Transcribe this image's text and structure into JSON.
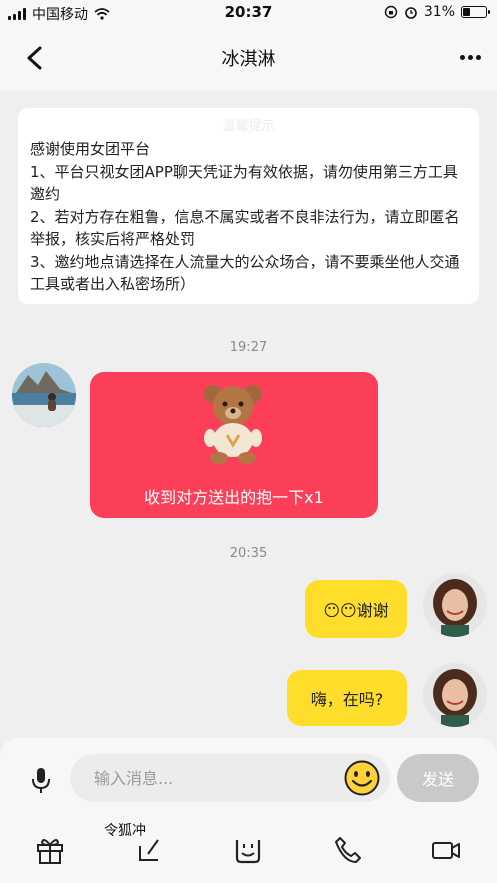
{
  "status_bar": {
    "carrier": "中国移动",
    "time": "20:37",
    "battery": "31%",
    "battery_level": 0.31
  },
  "header": {
    "title": "冰淇淋"
  },
  "notice": {
    "faint_title": "温馨提示",
    "lines": [
      "感谢使用女团平台",
      "1、平台只视女团APP聊天凭证为有效依据，请勿使用第三方工具邀约",
      "2、若对方存在粗鲁，信息不属实或者不良非法行为，请立即匿名举报，核实后将严格处罚",
      "3、邀约地点请选择在人流量大的公众场合，请不要乘坐他人交通工具或者出入私密场所）"
    ]
  },
  "messages": {
    "time_1": "19:27",
    "gift_text": "收到对方送出的抱一下x1",
    "time_2": "20:35",
    "msg_1": "😶😶谢谢",
    "msg_2": "嗨，在吗?"
  },
  "input": {
    "placeholder": "输入消息...",
    "send_label": "发送",
    "overlay_text": "令狐冲"
  },
  "icons": {
    "back": "chevron-left-icon",
    "more": "more-dots-icon",
    "mic": "microphone-icon",
    "emoji": "smiley-emoji-icon",
    "toolbar": [
      "gift-icon",
      "edit-icon",
      "smile-icon",
      "phone-icon",
      "video-camera-icon"
    ]
  },
  "colors": {
    "gift_bubble": "#fc3f58",
    "my_bubble": "#ffde2b",
    "send_button": "#c9c9c9",
    "background": "#efefef"
  }
}
